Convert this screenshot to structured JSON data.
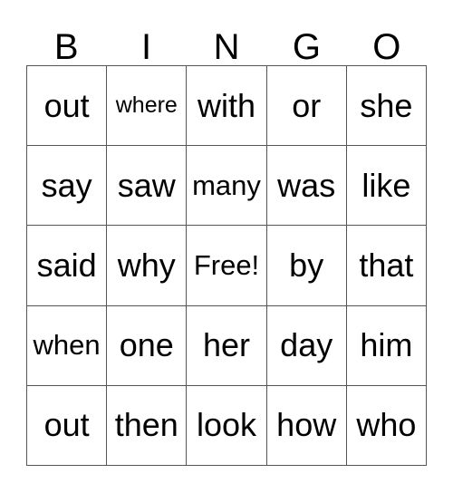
{
  "card": {
    "title": "BINGO",
    "background_color": "#ffffff",
    "text_color": "#000000",
    "border_color": "#555555"
  },
  "header": {
    "letters": [
      "B",
      "I",
      "N",
      "G",
      "O"
    ]
  },
  "grid": {
    "columns": 5,
    "rows": 5,
    "free_space": "Free!",
    "free_space_position": {
      "row": 3,
      "column": 3
    },
    "cells": [
      [
        {
          "text": "out",
          "size": "lg"
        },
        {
          "text": "where",
          "size": "sm"
        },
        {
          "text": "with",
          "size": "lg"
        },
        {
          "text": "or",
          "size": "lg"
        },
        {
          "text": "she",
          "size": "lg"
        }
      ],
      [
        {
          "text": "say",
          "size": "lg"
        },
        {
          "text": "saw",
          "size": "lg"
        },
        {
          "text": "many",
          "size": "md"
        },
        {
          "text": "was",
          "size": "lg"
        },
        {
          "text": "like",
          "size": "lg"
        }
      ],
      [
        {
          "text": "said",
          "size": "lg"
        },
        {
          "text": "why",
          "size": "lg"
        },
        {
          "text": "Free!",
          "size": "md"
        },
        {
          "text": "by",
          "size": "lg"
        },
        {
          "text": "that",
          "size": "lg"
        }
      ],
      [
        {
          "text": "when",
          "size": "md"
        },
        {
          "text": "one",
          "size": "lg"
        },
        {
          "text": "her",
          "size": "lg"
        },
        {
          "text": "day",
          "size": "lg"
        },
        {
          "text": "him",
          "size": "lg"
        }
      ],
      [
        {
          "text": "out",
          "size": "lg"
        },
        {
          "text": "then",
          "size": "lg"
        },
        {
          "text": "look",
          "size": "lg"
        },
        {
          "text": "how",
          "size": "lg"
        },
        {
          "text": "who",
          "size": "lg"
        }
      ]
    ]
  }
}
